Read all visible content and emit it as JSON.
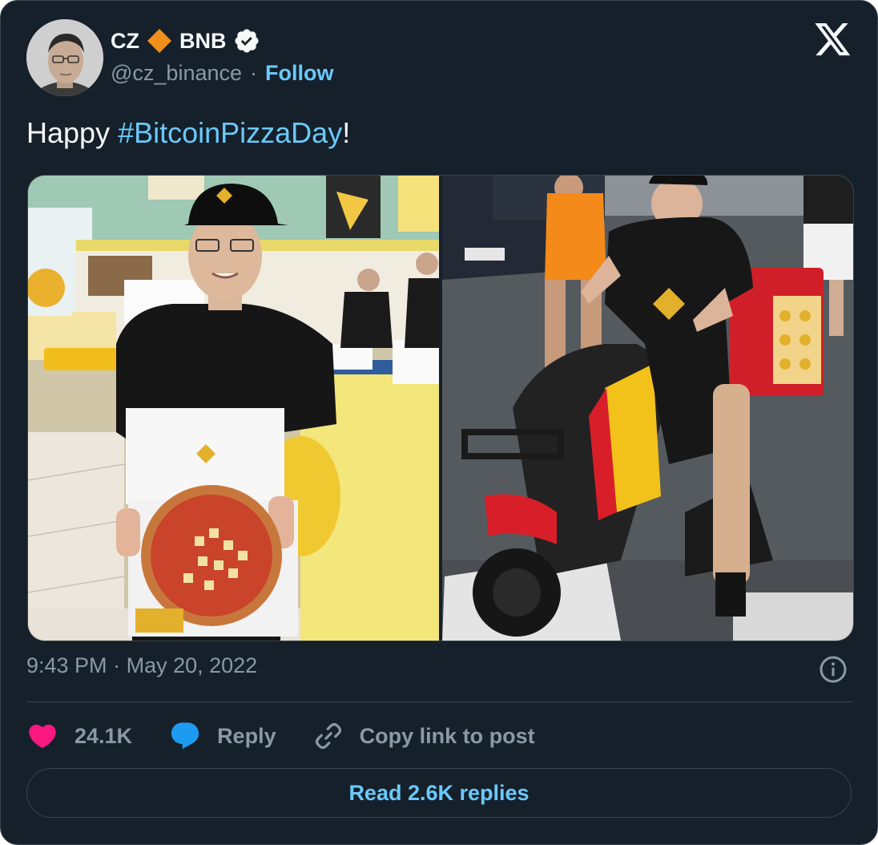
{
  "author": {
    "name": "CZ",
    "name_suffix": "BNB",
    "handle": "@cz_binance",
    "separator": "·",
    "follow_label": "Follow",
    "avatar_icon": "avatar-photo",
    "diamond_color": "#f0901a",
    "verified_icon": "verified-badge-icon"
  },
  "platform_icon": "x-logo-icon",
  "tweet": {
    "text_before": "Happy ",
    "hashtag": "#BitcoinPizzaDay",
    "text_after": "!"
  },
  "media": {
    "images": [
      {
        "name": "pizza-shop-photo"
      },
      {
        "name": "scooter-photo"
      }
    ]
  },
  "meta": {
    "time": "9:43 PM",
    "separator": "·",
    "date": "May 20, 2022",
    "info_icon": "info-icon"
  },
  "actions": {
    "like_count": "24.1K",
    "reply_label": "Reply",
    "copy_label": "Copy link to post",
    "like_color": "#f91880",
    "reply_color": "#1d9bf0"
  },
  "replies_button": {
    "label": "Read 2.6K replies"
  },
  "colors": {
    "background": "#15202b",
    "text": "#f7f9f9",
    "muted": "#8b98a5",
    "accent": "#6bc9fb",
    "border": "#38444d"
  }
}
